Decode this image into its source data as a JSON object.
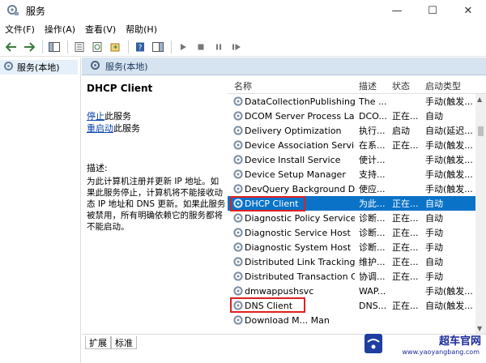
{
  "window": {
    "title": "服务",
    "minimize": "—",
    "maximize": "☐",
    "close": "✕"
  },
  "menu": [
    "文件(F)",
    "操作(A)",
    "查看(V)",
    "帮助(H)"
  ],
  "tree": {
    "root_label": "服务(本地)"
  },
  "right_header": {
    "label": "服务(本地)"
  },
  "details": {
    "service_title": "DHCP Client",
    "stop_link": "停止",
    "stop_suffix": "此服务",
    "restart_link": "重启动",
    "restart_suffix": "此服务",
    "desc_label": "描述:",
    "desc_text": "为此计算机注册并更新 IP 地址。如果此服务停止，计算机将不能接收动态 IP 地址和 DNS 更新。如果此服务被禁用，所有明确依赖它的服务都将不能启动。"
  },
  "list": {
    "columns": {
      "name": "名称",
      "description": "描述",
      "status": "状态",
      "startup": "启动类型"
    },
    "rows": [
      {
        "name": "DataCollectionPublishing...",
        "description": "The ...",
        "status": "",
        "startup": "手动(触发..."
      },
      {
        "name": "DCOM Server Process La...",
        "description": "DCO...",
        "status": "正在...",
        "startup": "自动"
      },
      {
        "name": "Delivery Optimization",
        "description": "执行...",
        "status": "启动",
        "startup": "自动(延迟..."
      },
      {
        "name": "Device Association Service",
        "description": "在系...",
        "status": "正在...",
        "startup": "手动(触发..."
      },
      {
        "name": "Device Install Service",
        "description": "使计...",
        "status": "",
        "startup": "手动(触发..."
      },
      {
        "name": "Device Setup Manager",
        "description": "支持...",
        "status": "",
        "startup": "手动(触发..."
      },
      {
        "name": "DevQuery Background D...",
        "description": "使应...",
        "status": "",
        "startup": "手动(触发..."
      },
      {
        "name": "DHCP Client",
        "description": "为此...",
        "status": "正在...",
        "startup": "自动"
      },
      {
        "name": "Diagnostic Policy Service",
        "description": "诊断...",
        "status": "正在...",
        "startup": "自动"
      },
      {
        "name": "Diagnostic Service Host",
        "description": "诊断...",
        "status": "正在...",
        "startup": "手动"
      },
      {
        "name": "Diagnostic System Host",
        "description": "诊断...",
        "status": "正在...",
        "startup": "手动"
      },
      {
        "name": "Distributed Link Tracking...",
        "description": "维护...",
        "status": "正在...",
        "startup": "自动"
      },
      {
        "name": "Distributed Transaction C...",
        "description": "协调...",
        "status": "正在...",
        "startup": "手动"
      },
      {
        "name": "dmwappushsvc",
        "description": "WAP...",
        "status": "",
        "startup": "手动(触发..."
      },
      {
        "name": "DNS Client",
        "description": "DNS...",
        "status": "正在...",
        "startup": "自动(触发..."
      },
      {
        "name": "Download M... Man",
        "description": "",
        "status": "",
        "startup": ""
      }
    ]
  },
  "tabs": {
    "extended": "扩展",
    "standard": "标准"
  },
  "watermark": {
    "text": "超车官网",
    "url": "www.yaoyangbang.com"
  },
  "colors": {
    "selected_row": "#0a73c8",
    "highlight_box": "#e02020",
    "header_band": "#d6e3f0"
  }
}
